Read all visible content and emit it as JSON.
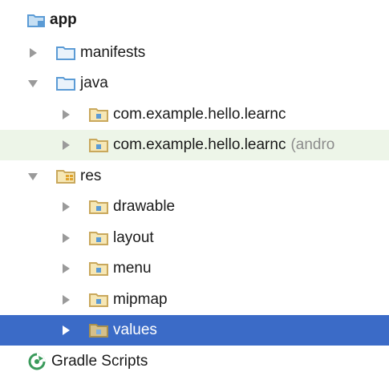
{
  "tree": {
    "app": {
      "label": "app"
    },
    "manifests": {
      "label": "manifests"
    },
    "java": {
      "label": "java"
    },
    "pkg_main": {
      "label": "com.example.hello.learnc"
    },
    "pkg_test": {
      "label": "com.example.hello.learnc",
      "suffix": "(andro"
    },
    "res": {
      "label": "res"
    },
    "drawable": {
      "label": "drawable"
    },
    "layout": {
      "label": "layout"
    },
    "menu": {
      "label": "menu"
    },
    "mipmap": {
      "label": "mipmap"
    },
    "values": {
      "label": "values"
    },
    "gradle": {
      "label": "Gradle Scripts"
    }
  },
  "colors": {
    "selection": "#3b6bc7",
    "test_row_highlight": "#edf5e8",
    "folder_blue": "#5b9bd5",
    "package_folder": "#c9a85c",
    "gradle_green": "#3a9a5b",
    "secondary_text": "#8c8c8c"
  },
  "icons": {
    "app": "module-folder-icon",
    "manifests": "folder-icon",
    "java": "folder-icon",
    "package": "package-folder-icon",
    "res": "resource-folder-icon",
    "gradle": "gradle-scripts-icon",
    "expanded": "triangle-down-icon",
    "collapsed": "triangle-right-icon"
  }
}
